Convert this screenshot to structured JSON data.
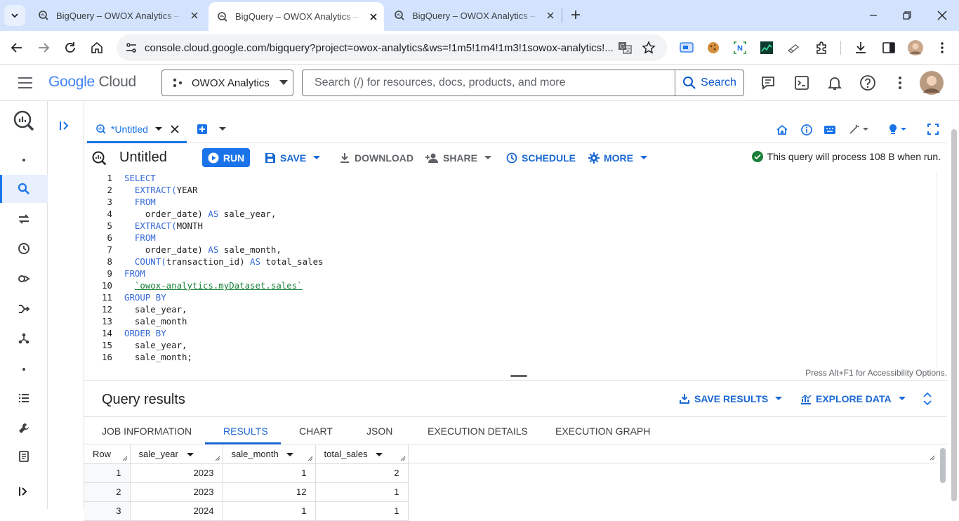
{
  "browser": {
    "tabs": [
      {
        "title": "BigQuery – OWOX Analytics – Google Cloud console",
        "active": false
      },
      {
        "title": "BigQuery – OWOX Analytics – Google Cloud console",
        "active": true
      },
      {
        "title": "BigQuery – OWOX Analytics – Google Cloud console",
        "active": false
      }
    ],
    "url": "console.cloud.google.com/bigquery?project=owox-analytics&ws=!1m5!1m4!1m3!1sowox-analytics!..."
  },
  "gc_header": {
    "logo_google": "Google",
    "logo_cloud": "Cloud",
    "project": "OWOX Analytics",
    "search_placeholder": "Search (/) for resources, docs, products, and more",
    "search_button": "Search"
  },
  "editor": {
    "tab_label": "*Untitled",
    "query_title": "Untitled",
    "run": "RUN",
    "save": "SAVE",
    "download": "DOWNLOAD",
    "share": "SHARE",
    "schedule": "SCHEDULE",
    "more": "MORE",
    "validator": "This query will process 108 B when run.",
    "a11y_hint": "Press Alt+F1 for Accessibility Options.",
    "lines": [
      {
        "n": "1",
        "parts": [
          {
            "t": "SELECT",
            "c": "kw"
          }
        ]
      },
      {
        "n": "2",
        "parts": [
          {
            "t": "  EXTRACT(",
            "c": "kw"
          },
          {
            "t": "YEAR",
            "c": "ctext"
          }
        ]
      },
      {
        "n": "3",
        "parts": [
          {
            "t": "  FROM",
            "c": "kw"
          }
        ]
      },
      {
        "n": "4",
        "parts": [
          {
            "t": "    order_date) ",
            "c": "ctext"
          },
          {
            "t": "AS",
            "c": "kw"
          },
          {
            "t": " sale_year,",
            "c": "ctext"
          }
        ]
      },
      {
        "n": "5",
        "parts": [
          {
            "t": "  EXTRACT(",
            "c": "kw"
          },
          {
            "t": "MONTH",
            "c": "ctext"
          }
        ]
      },
      {
        "n": "6",
        "parts": [
          {
            "t": "  FROM",
            "c": "kw"
          }
        ]
      },
      {
        "n": "7",
        "parts": [
          {
            "t": "    order_date) ",
            "c": "ctext"
          },
          {
            "t": "AS",
            "c": "kw"
          },
          {
            "t": " sale_month,",
            "c": "ctext"
          }
        ]
      },
      {
        "n": "8",
        "parts": [
          {
            "t": "  COUNT(",
            "c": "kw"
          },
          {
            "t": "transaction_id) ",
            "c": "ctext"
          },
          {
            "t": "AS",
            "c": "kw"
          },
          {
            "t": " total_sales",
            "c": "ctext"
          }
        ]
      },
      {
        "n": "9",
        "parts": [
          {
            "t": "FROM",
            "c": "kw"
          }
        ]
      },
      {
        "n": "10",
        "parts": [
          {
            "t": "  ",
            "c": "ctext"
          },
          {
            "t": "`owox-analytics.myDataset.sales`",
            "c": "str"
          }
        ]
      },
      {
        "n": "11",
        "parts": [
          {
            "t": "GROUP BY",
            "c": "kw"
          }
        ]
      },
      {
        "n": "12",
        "parts": [
          {
            "t": "  sale_year,",
            "c": "ctext"
          }
        ]
      },
      {
        "n": "13",
        "parts": [
          {
            "t": "  sale_month",
            "c": "ctext"
          }
        ]
      },
      {
        "n": "14",
        "parts": [
          {
            "t": "ORDER BY",
            "c": "kw"
          }
        ]
      },
      {
        "n": "15",
        "parts": [
          {
            "t": "  sale_year,",
            "c": "ctext"
          }
        ]
      },
      {
        "n": "16",
        "parts": [
          {
            "t": "  sale_month;",
            "c": "ctext"
          }
        ]
      }
    ]
  },
  "results": {
    "title": "Query results",
    "save_results": "SAVE RESULTS",
    "explore_data": "EXPLORE DATA",
    "tabs": [
      "JOB INFORMATION",
      "RESULTS",
      "CHART",
      "JSON",
      "EXECUTION DETAILS",
      "EXECUTION GRAPH"
    ],
    "active_tab": "RESULTS",
    "columns": [
      "Row",
      "sale_year",
      "sale_month",
      "total_sales"
    ],
    "rows": [
      [
        "1",
        "2023",
        "1",
        "2"
      ],
      [
        "2",
        "2023",
        "12",
        "1"
      ],
      [
        "3",
        "2024",
        "1",
        "1"
      ]
    ]
  },
  "colors": {
    "accent": "#1a73e8",
    "keyword": "#3367d6",
    "string": "#188038",
    "valid": "#188038"
  }
}
